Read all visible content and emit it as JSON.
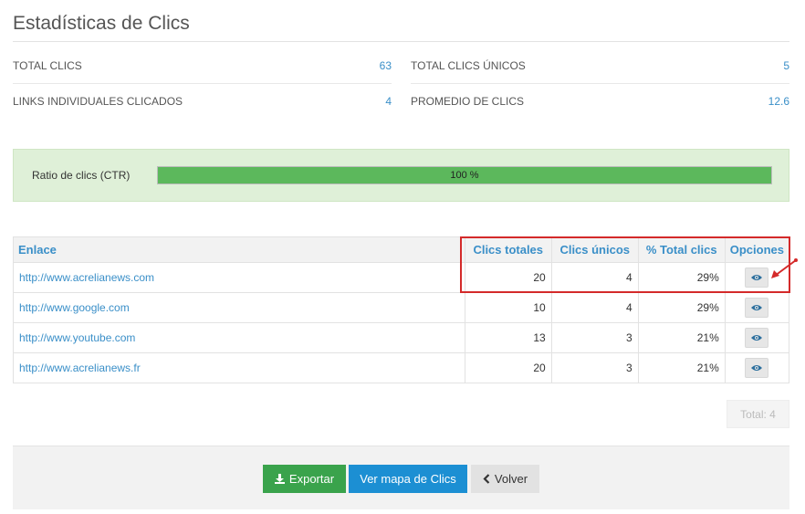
{
  "page": {
    "title": "Estadísticas de Clics"
  },
  "stats": [
    {
      "label": "TOTAL CLICS",
      "value": "63"
    },
    {
      "label": "TOTAL CLICS ÚNICOS",
      "value": "5"
    },
    {
      "label": "LINKS INDIVIDUALES CLICADOS",
      "value": "4"
    },
    {
      "label": "PROMEDIO DE CLICS",
      "value": "12.6"
    }
  ],
  "ctr": {
    "label": "Ratio de clics (CTR)",
    "value_text": "100 %",
    "fraction": 1.0,
    "fill_color": "#5cb85c"
  },
  "table": {
    "headers": {
      "link": "Enlace",
      "total": "Clics totales",
      "unique": "Clics únicos",
      "percent": "% Total clics",
      "options": "Opciones"
    },
    "rows": [
      {
        "url": "http://www.acrelianews.com",
        "total": "20",
        "unique": "4",
        "percent": "29%",
        "action": "eye-icon"
      },
      {
        "url": "http://www.google.com",
        "total": "10",
        "unique": "4",
        "percent": "29%",
        "action": "eye-icon"
      },
      {
        "url": "http://www.youtube.com",
        "total": "13",
        "unique": "3",
        "percent": "21%",
        "action": "eye-icon"
      },
      {
        "url": "http://www.acrelianews.fr",
        "total": "20",
        "unique": "3",
        "percent": "21%",
        "action": "eye-icon"
      }
    ]
  },
  "pagination": {
    "total_label": "Total: 4"
  },
  "actions": {
    "export_label": "Exportar",
    "map_label": "Ver mapa de Clics",
    "back_label": "Volver"
  },
  "colors": {
    "accent": "#3a8fc8",
    "highlight": "#d42a2a",
    "export": "#3aa34c",
    "map": "#1c8fd3"
  }
}
